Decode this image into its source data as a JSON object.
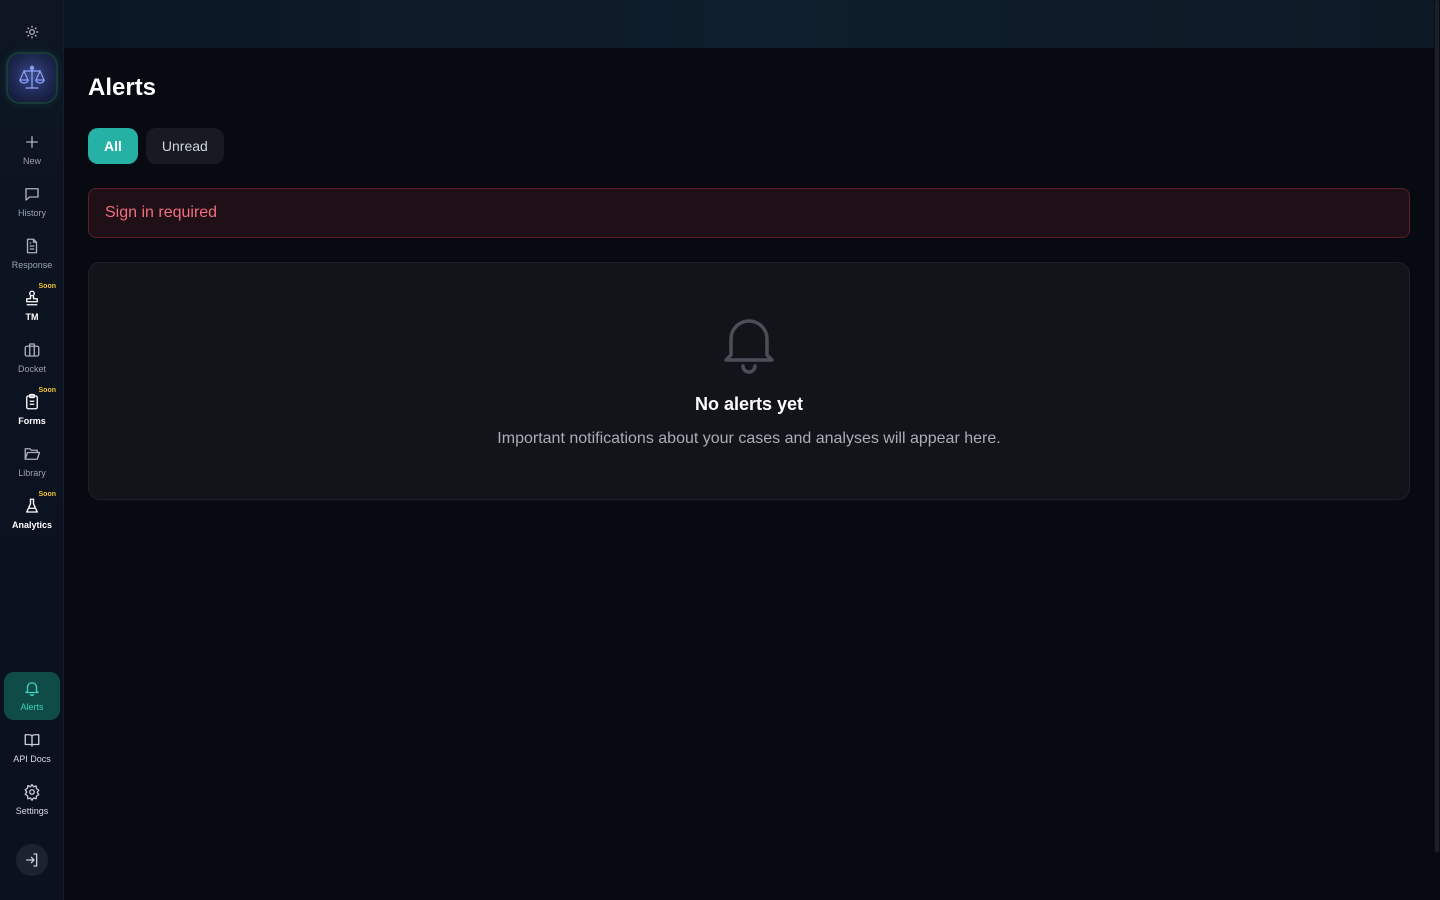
{
  "sidebar": {
    "items": [
      {
        "label": "New",
        "icon": "plus-icon"
      },
      {
        "label": "History",
        "icon": "chat-bubble-icon"
      },
      {
        "label": "Response",
        "icon": "document-icon"
      },
      {
        "label": "TM",
        "icon": "stamp-icon",
        "badge": "Soon"
      },
      {
        "label": "Docket",
        "icon": "briefcase-icon"
      },
      {
        "label": "Forms",
        "icon": "clipboard-icon",
        "badge": "Soon"
      },
      {
        "label": "Library",
        "icon": "folder-open-icon"
      },
      {
        "label": "Analytics",
        "icon": "flask-icon",
        "badge": "Soon"
      }
    ],
    "bottom_items": [
      {
        "label": "Alerts",
        "icon": "bell-icon",
        "active": true
      },
      {
        "label": "API Docs",
        "icon": "book-open-icon"
      },
      {
        "label": "Settings",
        "icon": "gear-icon"
      }
    ]
  },
  "page": {
    "title": "Alerts",
    "tabs": [
      {
        "label": "All",
        "active": true
      },
      {
        "label": "Unread",
        "active": false
      }
    ],
    "error": "Sign in required",
    "empty_state": {
      "title": "No alerts yet",
      "description": "Important notifications about your cases and analyses will appear here."
    }
  },
  "colors": {
    "accent": "#25b2a4",
    "active_nav": "#0f4b47",
    "error_text": "#f26d7d",
    "soon_badge": "#f1c232"
  }
}
